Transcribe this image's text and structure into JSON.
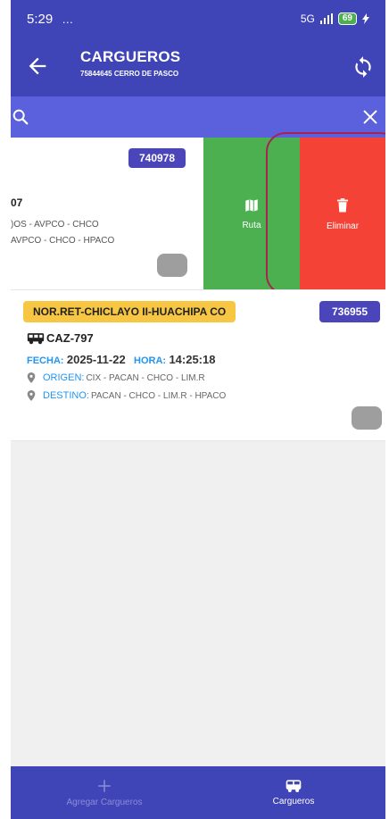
{
  "status_bar": {
    "time": "5:29",
    "extra": "… ",
    "network": "5G",
    "battery": "69"
  },
  "app_bar": {
    "title": "CARGUEROS",
    "subtitle": "75844645 CERRO DE PASCO"
  },
  "search": {
    "placeholder": ""
  },
  "cards": [
    {
      "id_badge": "740978",
      "plate_fragment": "07",
      "origin_fragment": ")OS - AVPCO - CHCO",
      "destination_fragment": "AVPCO - CHCO - HPACO",
      "swipe_actions": {
        "ruta_label": "Ruta",
        "eliminar_label": "Eliminar"
      }
    },
    {
      "route_name": "NOR.RET-CHICLAYO II-HUACHIPA CO",
      "id_badge": "736955",
      "plate": "CAZ-797",
      "fecha_label": "FECHA:",
      "fecha": "2025-11-22",
      "hora_label": "HORA:",
      "hora": "14:25:18",
      "origen_label": "ORIGEN:",
      "origen": "CIX - PACAN - CHCO - LIM.R",
      "destino_label": "DESTINO:",
      "destino": "PACAN - CHCO - LIM.R - HPACO"
    }
  ],
  "bottom_nav": {
    "add_label": "Agregar Cargueros",
    "cargueros_label": "Cargueros",
    "active": "Cargueros"
  },
  "colors": {
    "primary": "#3f44b6",
    "search": "#5b60dc",
    "ruta": "#4caf50",
    "eliminar": "#f44336",
    "route_badge": "#f7c744",
    "id_badge": "#4a45b8"
  }
}
